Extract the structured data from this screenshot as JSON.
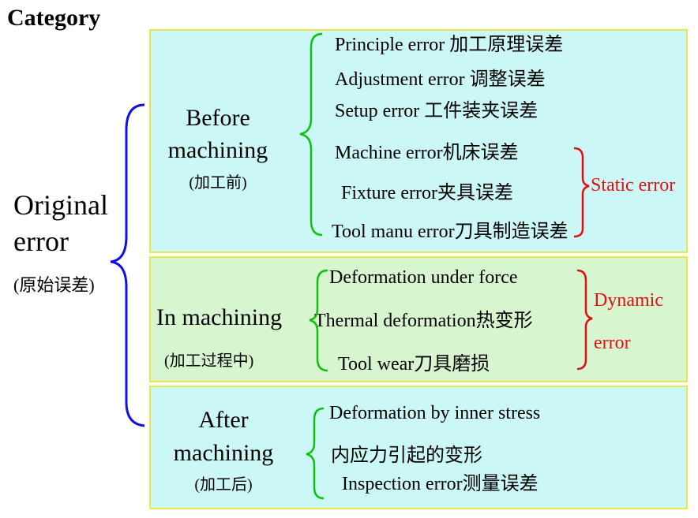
{
  "header": {
    "title": "Category"
  },
  "root": {
    "line1": "Original",
    "line2": "error",
    "sub": "(原始误差)"
  },
  "phases": [
    {
      "line1": "Before",
      "line2": "machining",
      "sub": "(加工前)",
      "items": [
        "Principle error 加工原理误差",
        "Adjustment error  调整误差",
        "Setup error  工件装夹误差",
        "Machine error机床误差",
        "Fixture error夹具误差",
        "Tool manu error刀具制造误差"
      ],
      "group_label": "Static error"
    },
    {
      "line1": "In machining",
      "sub": "(加工过程中)",
      "items": [
        "Deformation under force",
        "Thermal deformation热变形",
        "Tool wear刀具磨损"
      ],
      "group_label_1": "Dynamic",
      "group_label_2": "error"
    },
    {
      "line1": "After",
      "line2": "machining",
      "sub": "(加工后)",
      "items": [
        "Deformation by inner stress",
        "内应力引起的变形",
        "Inspection error测量误差"
      ]
    }
  ],
  "colors": {
    "root_brace": "#1010e0",
    "item_brace": "#10c010",
    "group_brace": "#e01010",
    "group_text": "#e01010",
    "panel_cyan": "#ccf7f7",
    "panel_green": "#d7f5cf",
    "panel_border": "#e8e84a"
  }
}
